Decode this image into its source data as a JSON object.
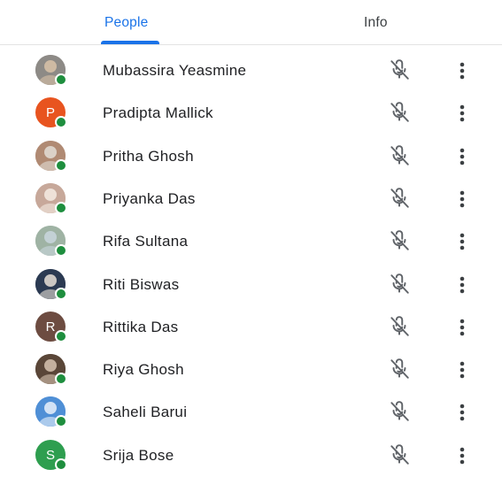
{
  "tabs": [
    {
      "label": "People",
      "selected": true
    },
    {
      "label": "Info",
      "selected": false
    }
  ],
  "colors": {
    "accent": "#1a73e8",
    "presence": "#1e8e3e"
  },
  "participants": [
    {
      "name": "Mubassira Yeasmine",
      "avatar": "photo",
      "avatar_color": "#8d8a86",
      "initial": ""
    },
    {
      "name": "Pradipta Mallick",
      "avatar": "letter",
      "avatar_color": "#e8541f",
      "initial": "P"
    },
    {
      "name": "Pritha Ghosh",
      "avatar": "photo",
      "avatar_color": "#b08a73",
      "initial": ""
    },
    {
      "name": "Priyanka Das",
      "avatar": "photo",
      "avatar_color": "#c7a89a",
      "initial": ""
    },
    {
      "name": "Rifa Sultana",
      "avatar": "photo",
      "avatar_color": "#9fb3a4",
      "initial": ""
    },
    {
      "name": "Riti Biswas",
      "avatar": "photo",
      "avatar_color": "#2b3a52",
      "initial": ""
    },
    {
      "name": "Rittika Das",
      "avatar": "letter",
      "avatar_color": "#6d4c41",
      "initial": "R"
    },
    {
      "name": "Riya Ghosh",
      "avatar": "photo",
      "avatar_color": "#5a4638",
      "initial": ""
    },
    {
      "name": "Saheli Barui",
      "avatar": "photo",
      "avatar_color": "#4f8fd6",
      "initial": ""
    },
    {
      "name": "Srija Bose",
      "avatar": "letter",
      "avatar_color": "#2e9e4f",
      "initial": "S"
    }
  ],
  "icons": {
    "mic": "mic-off-icon",
    "more": "more-vert-icon"
  }
}
